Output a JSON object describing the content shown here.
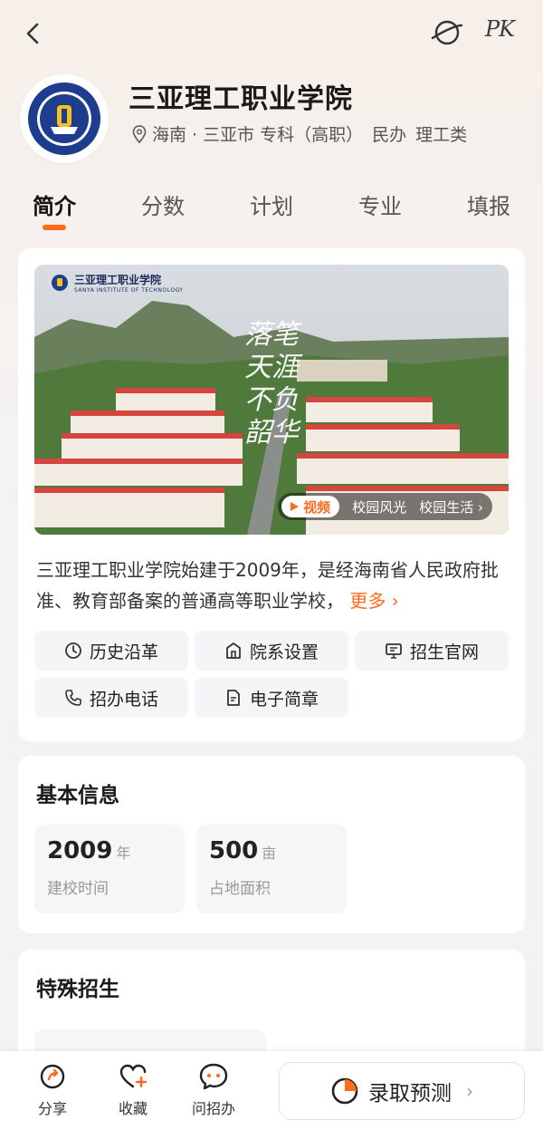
{
  "header": {
    "back_icon": "chevron-left-icon",
    "planet_icon": "planet-icon",
    "pk_label": "PK"
  },
  "school": {
    "name": "三亚理工职业学院",
    "location": "海南 · 三亚市",
    "level": "专科（高职）",
    "ownership": "民办",
    "category": "理工类",
    "logo_text": "SANYA INSTITUTE OF TECHNOLOGY",
    "logo_cn": "三亚理工职业学院"
  },
  "tabs": [
    {
      "label": "简介",
      "active": true
    },
    {
      "label": "分数",
      "active": false
    },
    {
      "label": "计划",
      "active": false
    },
    {
      "label": "专业",
      "active": false
    },
    {
      "label": "填报",
      "active": false
    }
  ],
  "intro": {
    "video_brand": "三亚理工职业学院",
    "video_brand_en": "SANYA INSTITUTE OF TECHNOLOGY",
    "calligraphy": "落笔天涯 不负韶华",
    "video_play_label": "视频",
    "video_tags": [
      "校园风光",
      "校园生活"
    ],
    "text": "三亚理工职业学院始建于2009年，是经海南省人民政府批准、教育部备案的普通高等职业学校，",
    "more_label": "更多",
    "buttons": [
      {
        "label": "历史沿革",
        "icon": "clock-icon"
      },
      {
        "label": "院系设置",
        "icon": "building-icon"
      },
      {
        "label": "招生官网",
        "icon": "monitor-icon"
      },
      {
        "label": "招办电话",
        "icon": "phone-icon"
      },
      {
        "label": "电子简章",
        "icon": "document-icon"
      }
    ]
  },
  "basic_info": {
    "title": "基本信息",
    "stats": [
      {
        "value": "2009",
        "unit": "年",
        "label": "建校时间"
      },
      {
        "value": "500",
        "unit": "亩",
        "label": "占地面积"
      }
    ]
  },
  "special": {
    "title": "特殊招生"
  },
  "bottom_bar": {
    "share": "分享",
    "favorite": "收藏",
    "ask": "问招办",
    "predict": "录取预测"
  },
  "colors": {
    "accent": "#ff6b1a",
    "logo_blue": "#1f3d8f"
  }
}
